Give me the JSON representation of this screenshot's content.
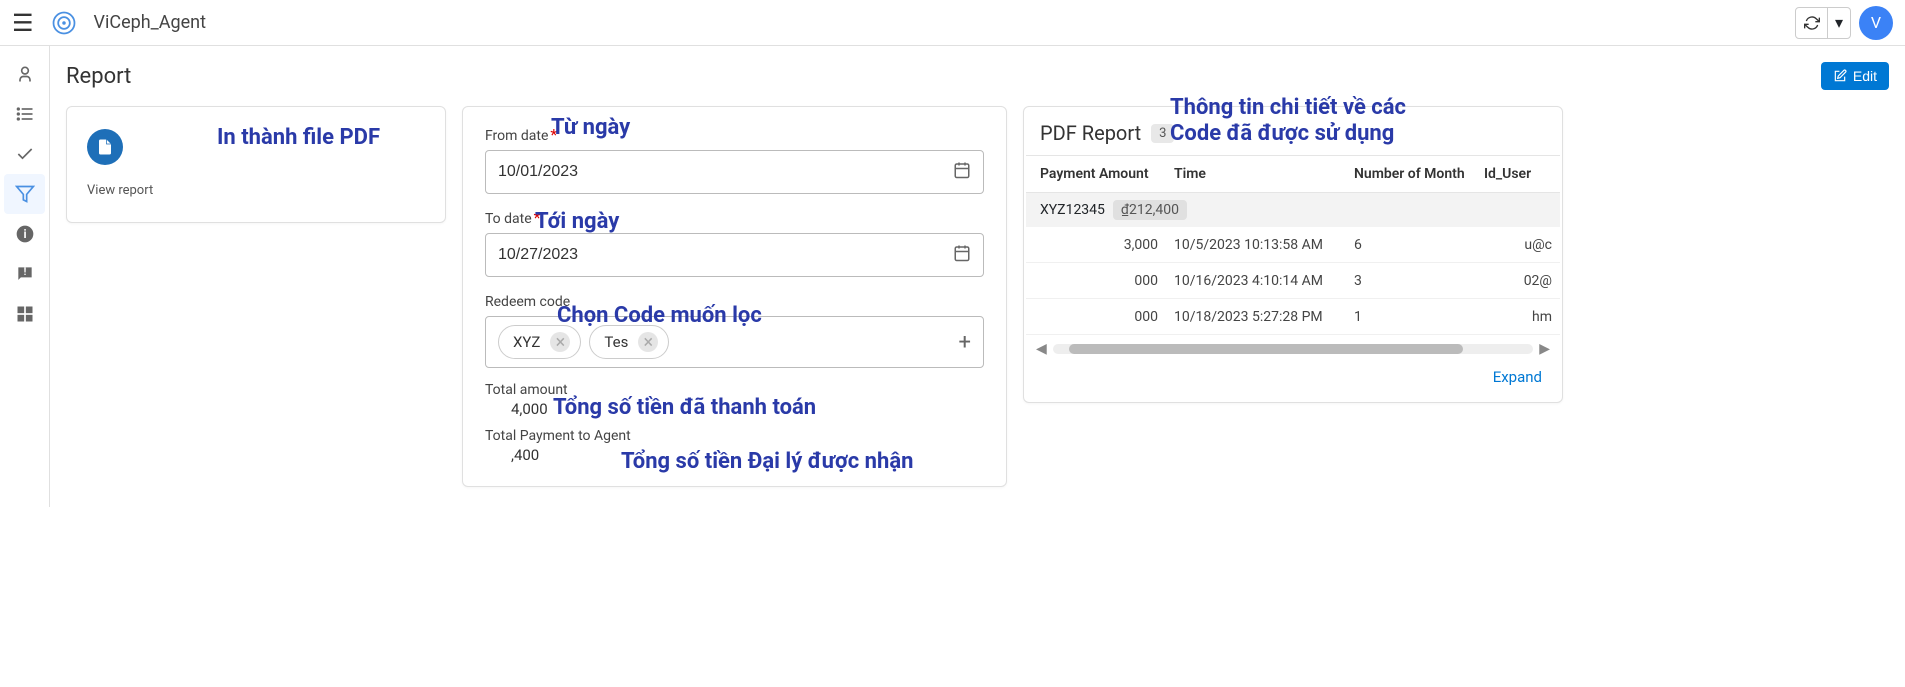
{
  "header": {
    "app_title": "ViCeph_Agent",
    "avatar": "V"
  },
  "page": {
    "title": "Report",
    "edit_label": "Edit"
  },
  "pdf_card": {
    "view_report": "View report"
  },
  "form": {
    "from_label": "From date",
    "from_value": "10/01/2023",
    "to_label": "To date",
    "to_value": "10/27/2023",
    "redeem_label": "Redeem code",
    "chips": [
      "XYZ",
      "Tes"
    ],
    "total_amount_label": "Total amount",
    "total_amount_value": "4,000",
    "total_payment_label": "Total Payment to Agent",
    "total_payment_value": ",400"
  },
  "report": {
    "title": "PDF Report",
    "count": "3",
    "columns": {
      "c1": "Payment Amount",
      "c2": "Time",
      "c3": "Number of Month",
      "c4": "Id_User"
    },
    "group": {
      "code": "XYZ12345",
      "amount": "₫212,400"
    },
    "rows": [
      {
        "amt": "3,000",
        "time": "10/5/2023 10:13:58 AM",
        "months": "6",
        "user": "u@c"
      },
      {
        "amt": "000",
        "time": "10/16/2023 4:10:14 AM",
        "months": "3",
        "user": "02@"
      },
      {
        "amt": "000",
        "time": "10/18/2023 5:27:28 PM",
        "months": "1",
        "user": "hm"
      }
    ],
    "expand": "Expand"
  },
  "annotations": {
    "pdf": "In thành file PDF",
    "from": "Từ ngày",
    "to": "Tới ngày",
    "redeem": "Chọn Code muốn lọc",
    "total_amount": "Tổng số tiền đã thanh toán",
    "total_payment": "Tổng số tiền Đại lý được nhận",
    "report_detail_l1": "Thông tin chi tiết về các",
    "report_detail_l2": "Code đã được sử dụng"
  }
}
